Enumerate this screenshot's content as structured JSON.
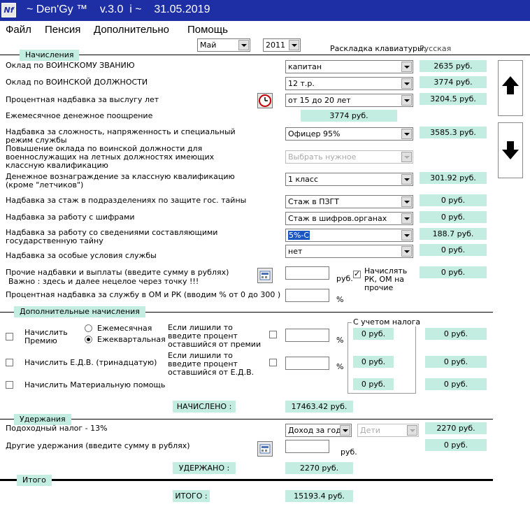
{
  "titlebar": {
    "icon_text": "Nf",
    "title": "~ Den'Gy ™    v.3.0  i ~    31.05.2019"
  },
  "menu": {
    "items": [
      "Файл",
      "Пенсия",
      "Дополнительно",
      "Помощь"
    ]
  },
  "top": {
    "month": "Май",
    "year": "2011",
    "keyboard_label": "Раскладка клавиатуры:",
    "keyboard_value": "Русская"
  },
  "sections": {
    "accruals": "Начисления",
    "additional": "Дополнительные начисления",
    "deductions": "Удержания",
    "total": "Итого"
  },
  "rows": [
    {
      "label": "Оклад по ВОИНСКОМУ ЗВАНИЮ",
      "combo": "капитан",
      "result": "2635 руб."
    },
    {
      "label": "Оклад по ВОИНСКОЙ ДОЛЖНОСТИ",
      "combo": "12 т.р.",
      "result": "3774 руб."
    },
    {
      "label": "Процентная надбавка за выслугу лет",
      "combo": "от 15 до 20 лет",
      "result": "3204.5 руб."
    },
    {
      "label": "Ежемесячное денежное поощрение",
      "result": "3774 руб."
    },
    {
      "label": "Надбавка за сложность, напряженность и специальный режим службы",
      "combo": "Офицер 95%",
      "result": "3585.3 руб."
    },
    {
      "label": "Повышение оклада по воинской должности для военнослужащих на летных должностях имеющих классную квалификацию",
      "combo": "Выбрать нужное"
    },
    {
      "label": "Денежное вознаграждение за классную квалификацию (кроме \"летчиков\")",
      "combo": "1 класс",
      "result": "301.92 руб."
    },
    {
      "label": "Надбавка за стаж в подразделениях по защите гос. тайны",
      "combo": "Стаж в ПЗГТ",
      "result": "0 руб."
    },
    {
      "label": "Надбавка  за работу с шифрами",
      "combo": "Стаж в шифров.органах",
      "result": "0 руб."
    },
    {
      "label": "Надбавка  за работу со сведениями составляющими государственную тайну",
      "combo": "5%-С",
      "result": "188.7 руб."
    },
    {
      "label": "Надбавка за особые условия службы",
      "combo": "нет",
      "result": "0 руб."
    }
  ],
  "other": {
    "label_line1": "Прочие надбавки и выплаты (введите сумму в рублях)",
    "label_line2": "Важно : здесь и далее нецелое через точку !!!",
    "unit": "руб.",
    "check_label": "Начислять РК, ОМ на прочие",
    "result": "0 руб.",
    "percent_label": "Процентная надбавка за службу в ОМ и РК (вводим %  от 0 до 300 )",
    "percent_unit": "%"
  },
  "additional": {
    "bonus_label": "Начислить Премию",
    "radio_monthly": "Ежемесячная",
    "radio_quarterly": "Ежеквартальная",
    "bonus_hint": "Если лишили то введите процент оставшийся от премии",
    "edv_label": "Начислить Е.Д.В. (тринадцатую)",
    "edv_hint": "Если лишили то введите процент оставшийся от Е.Д.В.",
    "aid_label": "Начислить Материальную помощь",
    "tax_group": "С учетом налога",
    "percent_unit": "%",
    "values": [
      "0 руб.",
      "0 руб.",
      "0 руб."
    ],
    "values_taxed": [
      "0 руб.",
      "0 руб.",
      "0 руб."
    ],
    "accrued_label": "НАЧИСЛЕНО :",
    "accrued_value": "17463.42 руб."
  },
  "deductions": {
    "tax_label": "Подоходный налог - 13%",
    "tax_combo": "Доход за год",
    "children_combo": "Дети",
    "tax_value": "2270 руб.",
    "other_label": "Другие удержания (введите сумму в рублях)",
    "other_unit": "руб.",
    "other_value": "0 руб.",
    "deducted_label": "УДЕРЖАНО :",
    "deducted_value": "2270 руб."
  },
  "total": {
    "label": "ИТОГО :",
    "value": "15193.4 руб."
  }
}
